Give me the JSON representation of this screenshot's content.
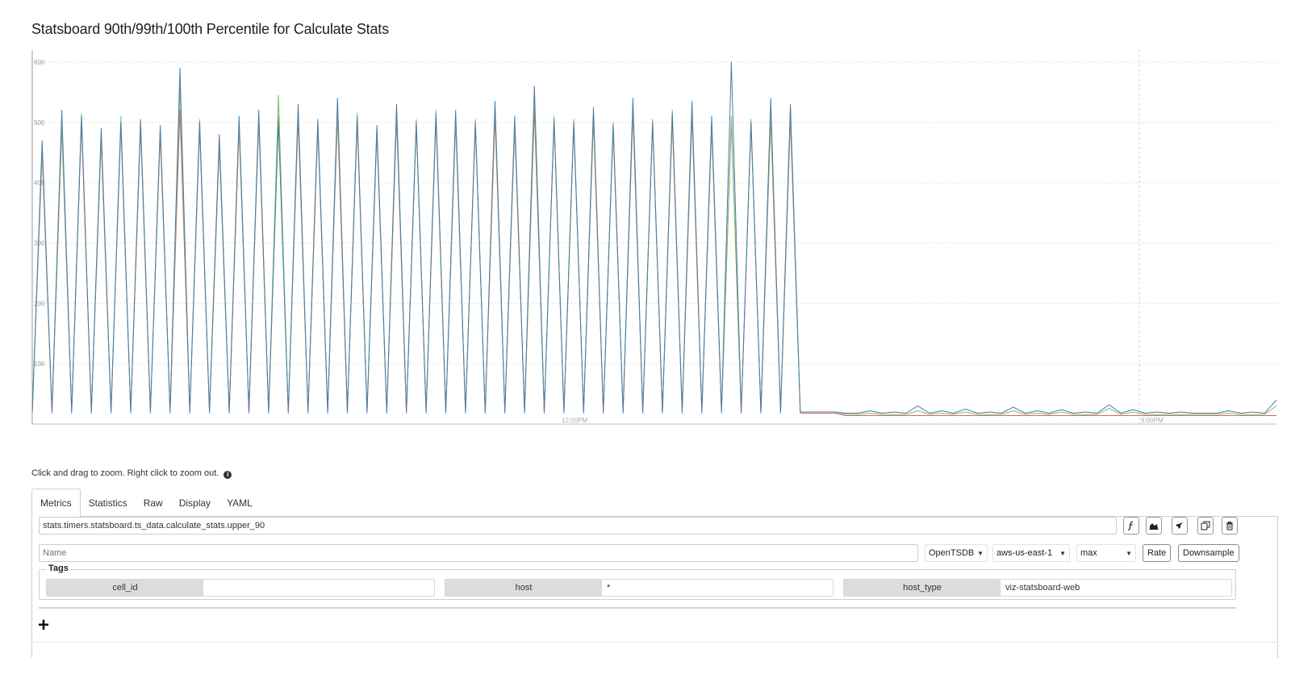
{
  "chart_data": {
    "type": "line",
    "title": "Statsboard 90th/99th/100th Percentile for Calculate Stats",
    "ylim": [
      0,
      620
    ],
    "y_ticks": [
      100,
      200,
      300,
      400,
      500,
      600
    ],
    "x_tick_labels": [
      "12:00PM",
      "6:00PM"
    ],
    "grid": true,
    "series": [
      {
        "color": "#4a7bab",
        "values": [
          20,
          470,
          20,
          520,
          20,
          510,
          20,
          490,
          20,
          500,
          20,
          505,
          20,
          495,
          20,
          590,
          20,
          500,
          20,
          480,
          20,
          510,
          20,
          520,
          20,
          500,
          20,
          530,
          20,
          505,
          20,
          540,
          20,
          510,
          20,
          495,
          20,
          530,
          20,
          500,
          20,
          515,
          20,
          520,
          20,
          500,
          20,
          535,
          20,
          510,
          20,
          560,
          20,
          505,
          20,
          500,
          20,
          525,
          20,
          495,
          20,
          540,
          20,
          500,
          20,
          515,
          20,
          535,
          20,
          510,
          20,
          600,
          20,
          500,
          20,
          540,
          20,
          530,
          20,
          20,
          20,
          20,
          20,
          18,
          18,
          22,
          18,
          20,
          18,
          30,
          18,
          22,
          18,
          25,
          18,
          20,
          18,
          28,
          18,
          22,
          18,
          24,
          18,
          20,
          18,
          32,
          18,
          24,
          18,
          20,
          18,
          20,
          18,
          18,
          18,
          22,
          18,
          20,
          18,
          40
        ]
      },
      {
        "color": "#7cbf6a",
        "values": [
          20,
          460,
          20,
          500,
          20,
          515,
          20,
          480,
          20,
          510,
          20,
          500,
          20,
          490,
          20,
          560,
          20,
          505,
          20,
          470,
          20,
          500,
          20,
          510,
          20,
          545,
          20,
          520,
          20,
          500,
          20,
          525,
          20,
          515,
          20,
          490,
          20,
          520,
          20,
          505,
          20,
          520,
          20,
          510,
          20,
          505,
          20,
          525,
          20,
          500,
          20,
          540,
          20,
          510,
          20,
          505,
          20,
          515,
          20,
          500,
          20,
          530,
          20,
          505,
          20,
          520,
          20,
          525,
          20,
          500,
          20,
          510,
          20,
          505,
          20,
          520,
          20,
          520,
          20,
          20,
          20,
          20,
          20,
          16,
          16,
          18,
          16,
          16,
          16,
          22,
          16,
          18,
          16,
          20,
          16,
          16,
          16,
          22,
          16,
          18,
          16,
          20,
          16,
          16,
          16,
          26,
          16,
          20,
          16,
          16,
          16,
          16,
          16,
          16,
          16,
          18,
          16,
          16,
          16,
          30
        ]
      },
      {
        "color": "#d9665a",
        "values": [
          18,
          450,
          18,
          490,
          18,
          500,
          18,
          470,
          18,
          495,
          18,
          490,
          18,
          480,
          18,
          520,
          18,
          490,
          18,
          460,
          18,
          490,
          18,
          500,
          18,
          510,
          18,
          505,
          18,
          490,
          18,
          510,
          18,
          500,
          18,
          480,
          18,
          505,
          18,
          495,
          18,
          505,
          18,
          500,
          18,
          495,
          18,
          510,
          18,
          490,
          18,
          520,
          18,
          500,
          18,
          495,
          18,
          505,
          18,
          490,
          18,
          515,
          18,
          495,
          18,
          505,
          18,
          510,
          18,
          490,
          18,
          500,
          18,
          495,
          18,
          505,
          18,
          505,
          18,
          18,
          18,
          18,
          18,
          14,
          14,
          14,
          14,
          14,
          14,
          14,
          14,
          14,
          14,
          14,
          14,
          14,
          14,
          14,
          14,
          14,
          14,
          14,
          14,
          14,
          14,
          14,
          14,
          14,
          14,
          14,
          14,
          14,
          14,
          14,
          14,
          14,
          14,
          14,
          14,
          14
        ]
      }
    ]
  },
  "hint": {
    "text": "Click and drag to zoom. Right click to zoom out.",
    "info_icon": "info-circle-icon"
  },
  "tabs": [
    {
      "label": "Metrics",
      "active": true
    },
    {
      "label": "Statistics"
    },
    {
      "label": "Raw"
    },
    {
      "label": "Display"
    },
    {
      "label": "YAML"
    }
  ],
  "metric": {
    "value": "stats.timers.statsboard.ts_data.calculate_stats.upper_90"
  },
  "metric_icons": [
    "function-icon",
    "area-chart-icon",
    "rocket-icon",
    "copy-icon",
    "trash-icon"
  ],
  "name_field": {
    "placeholder": "Name"
  },
  "selects": {
    "source": "OpenTSDB",
    "region": "aws-us-east-1",
    "aggregator": "max"
  },
  "buttons": {
    "rate": "Rate",
    "downsample": "Downsample"
  },
  "tags": {
    "legend": "Tags",
    "items": [
      {
        "key": "cell_id",
        "value": ""
      },
      {
        "key": "host",
        "value": "*"
      },
      {
        "key": "host_type",
        "value": "viz-statsboard-web"
      }
    ]
  }
}
